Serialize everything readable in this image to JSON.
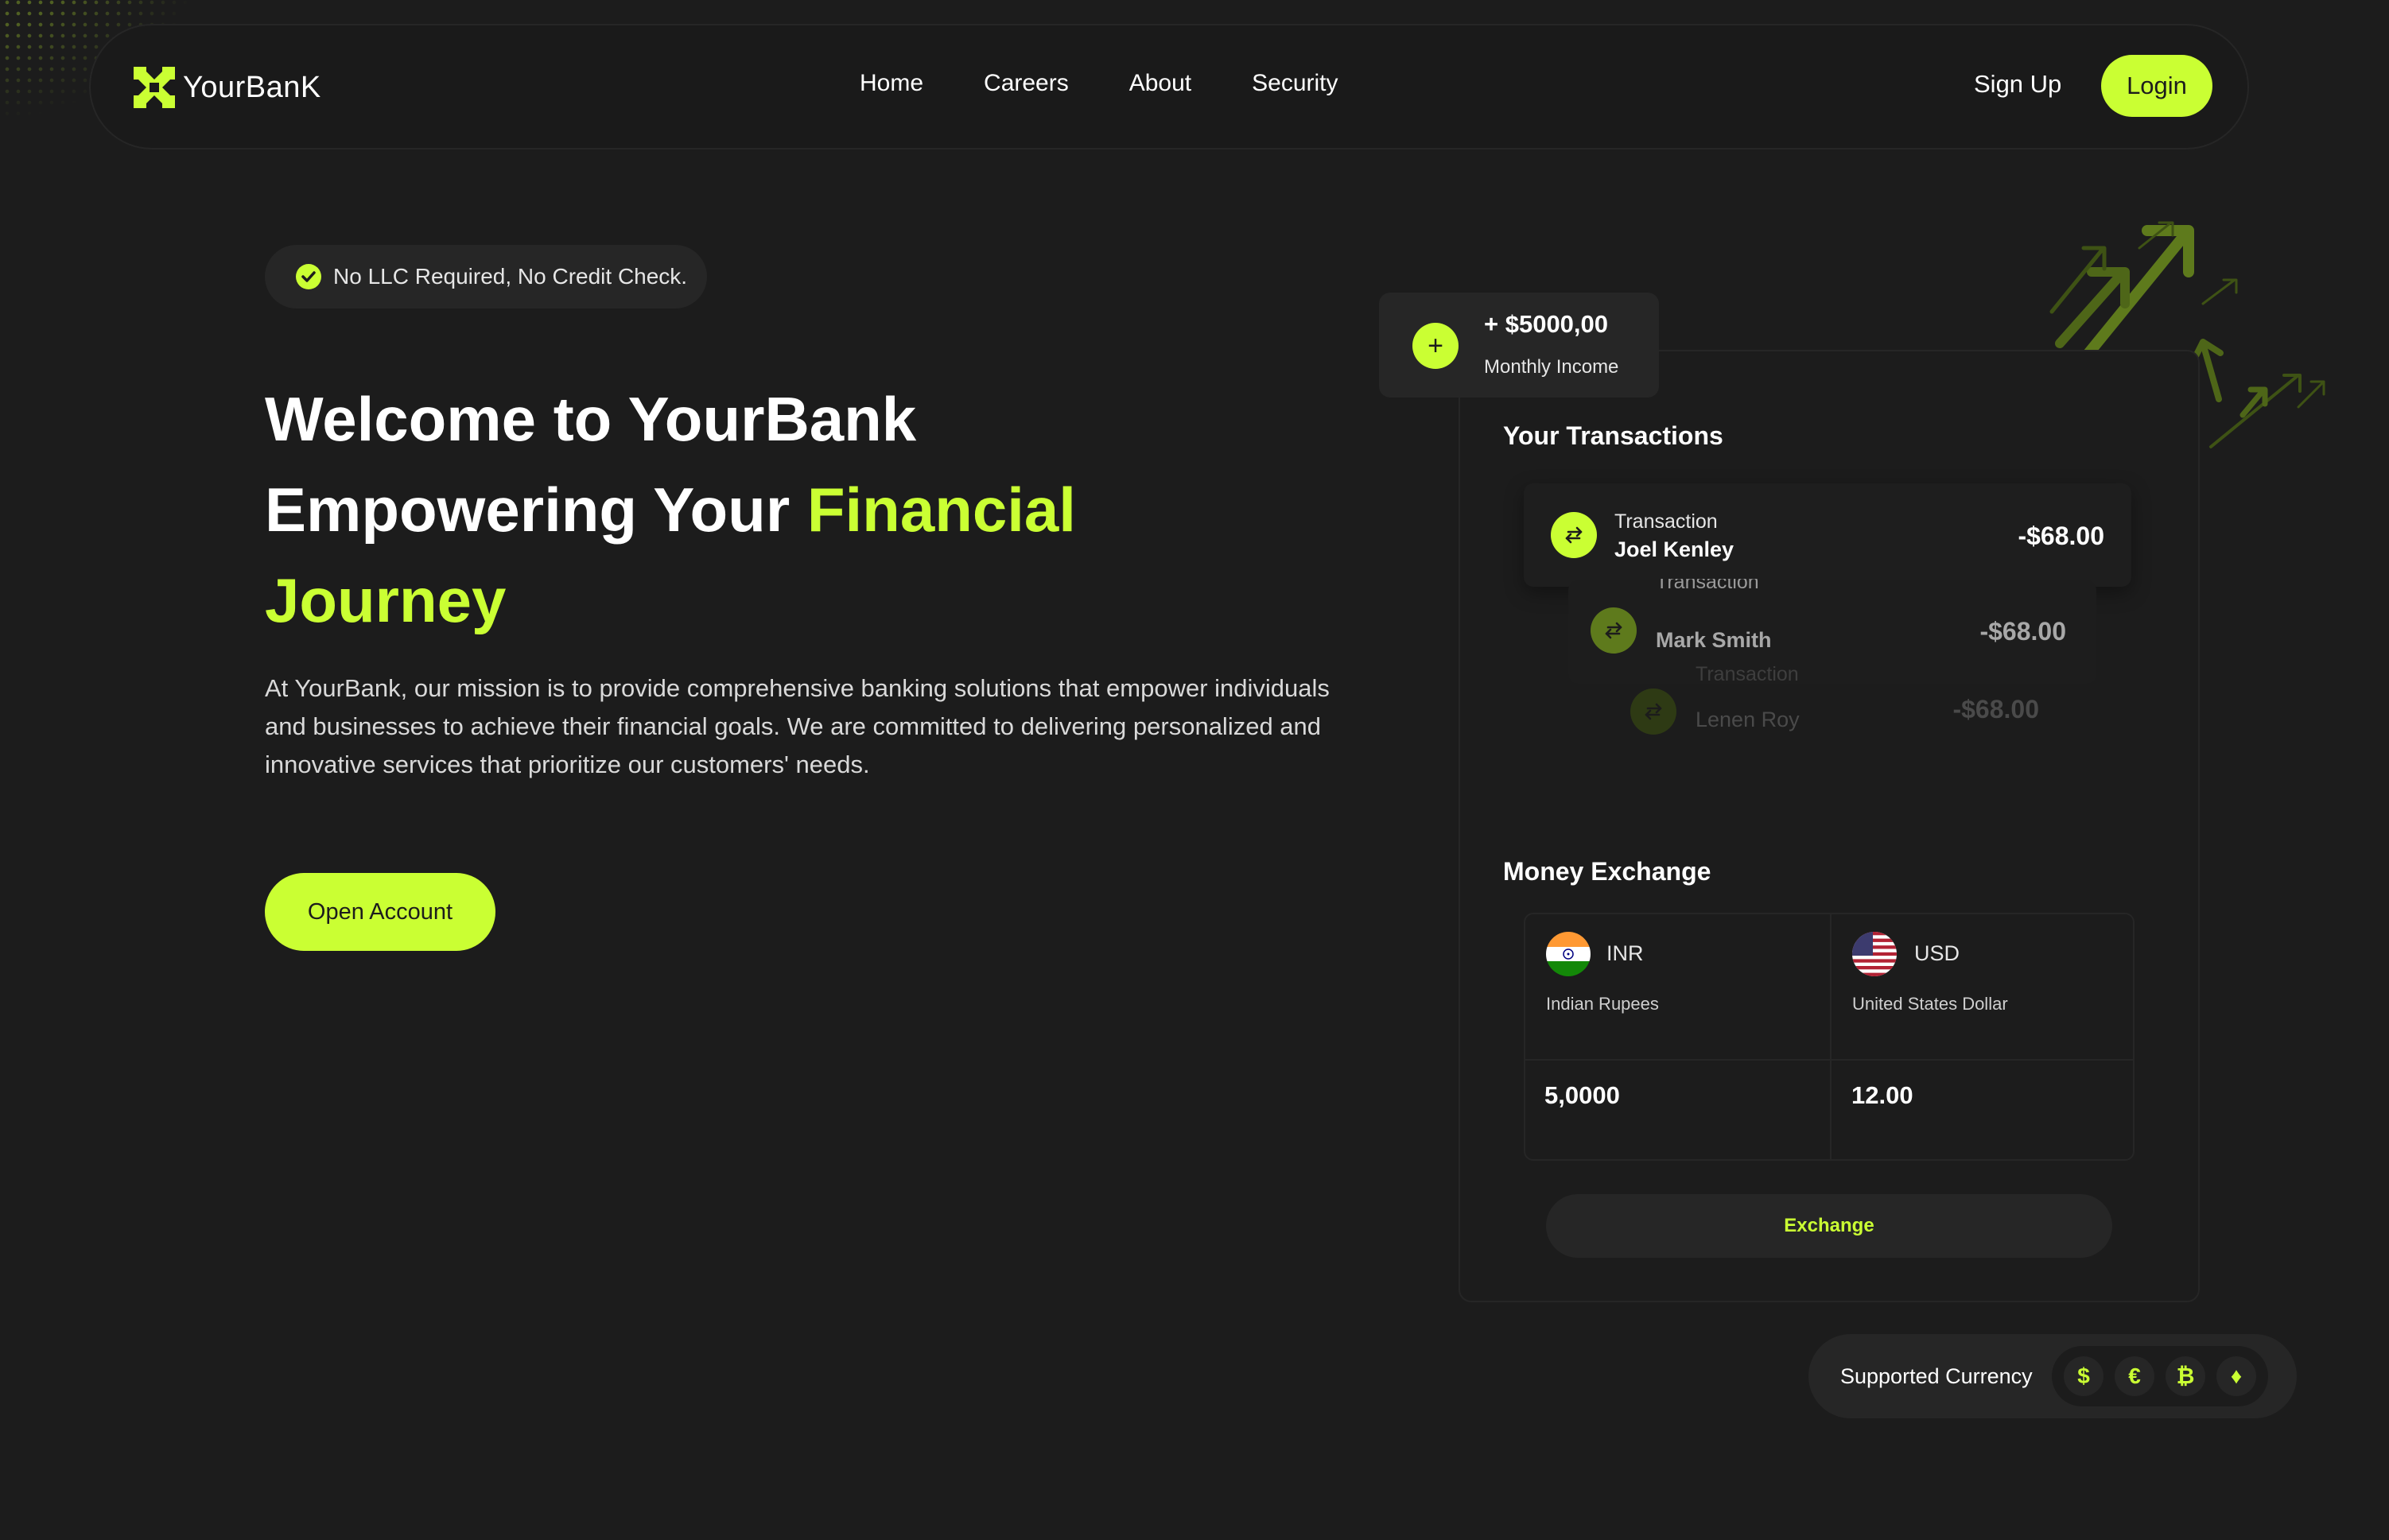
{
  "brand": {
    "name": "YourBanK",
    "accent": "#caff33",
    "background": "#1c1c1c",
    "surface": "#262626"
  },
  "nav": {
    "links": [
      "Home",
      "Careers",
      "About",
      "Security"
    ],
    "signup": "Sign Up",
    "login": "Login"
  },
  "hero": {
    "badge": "No LLC Required, No Credit Check.",
    "title_line1": "Welcome to YourBank",
    "title_line2_plain": "Empowering Your ",
    "title_line2_accent": "Financial",
    "title_line3_accent": "Journey",
    "description": "At YourBank, our mission is to provide comprehensive banking solutions that empower individuals and businesses to achieve their financial goals. We are committed to delivering personalized and innovative services that prioritize our customers' needs.",
    "cta": "Open Account"
  },
  "income": {
    "icon": "plus-icon",
    "amount": "+ $5000,00",
    "label": "Monthly Income"
  },
  "transactions": {
    "title": "Your Transactions",
    "items": [
      {
        "label": "Transaction",
        "name": "Joel Kenley",
        "amount": "-$68.00",
        "icon": "swap-icon"
      },
      {
        "label": "Transaction",
        "name": "Mark Smith",
        "amount": "-$68.00",
        "icon": "swap-icon"
      },
      {
        "label": "Transaction",
        "name": "Lenen Roy",
        "amount": "-$68.00",
        "icon": "swap-icon"
      }
    ]
  },
  "exchange": {
    "title": "Money Exchange",
    "from": {
      "code": "INR",
      "name": "Indian Rupees",
      "value": "5,0000",
      "flag": "india-flag-icon"
    },
    "to": {
      "code": "USD",
      "name": "United States Dollar",
      "value": "12.00",
      "flag": "us-flag-icon"
    },
    "button": "Exchange"
  },
  "supported": {
    "label": "Supported Currency",
    "coins": [
      {
        "symbol": "$",
        "icon": "dollar-icon"
      },
      {
        "symbol": "€",
        "icon": "euro-icon"
      },
      {
        "symbol": "₿",
        "icon": "bitcoin-icon"
      },
      {
        "symbol": "♦",
        "icon": "ethereum-icon"
      }
    ]
  }
}
